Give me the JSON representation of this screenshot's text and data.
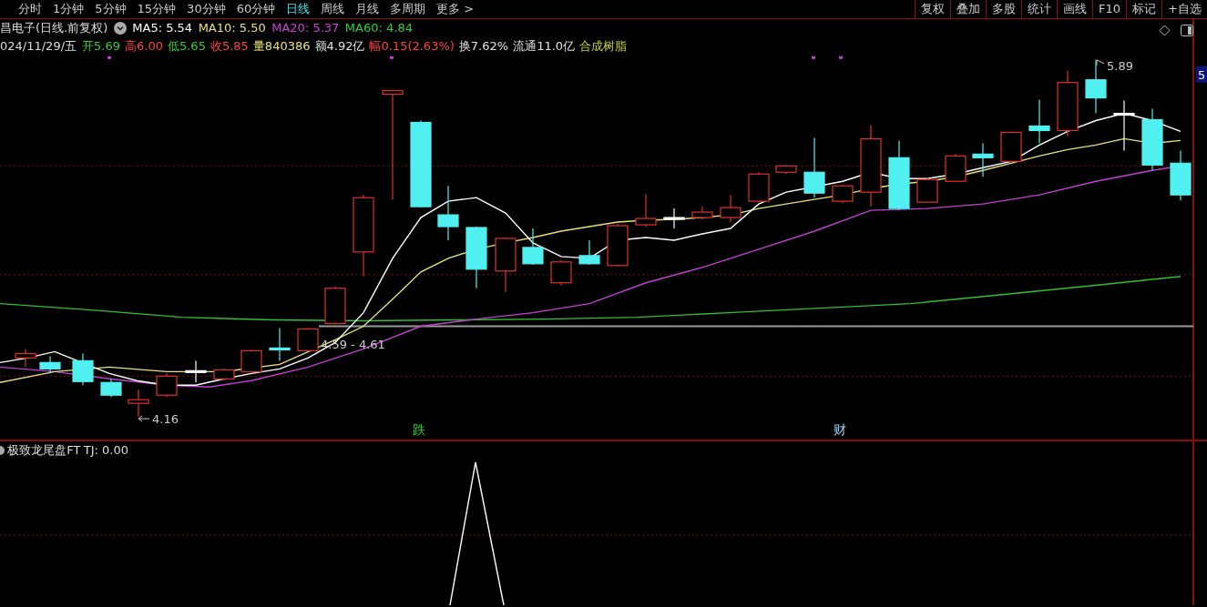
{
  "toolbar": {
    "period_tabs": [
      {
        "label": "分时",
        "selected": false
      },
      {
        "label": "1分钟",
        "selected": false
      },
      {
        "label": "5分钟",
        "selected": false
      },
      {
        "label": "15分钟",
        "selected": false
      },
      {
        "label": "30分钟",
        "selected": false
      },
      {
        "label": "60分钟",
        "selected": false
      },
      {
        "label": "日线",
        "selected": true
      },
      {
        "label": "周线",
        "selected": false
      },
      {
        "label": "月线",
        "selected": false
      },
      {
        "label": "多周期",
        "selected": false
      },
      {
        "label": "更多 >",
        "selected": false
      }
    ],
    "tools": [
      "复权",
      "叠加",
      "多股",
      "统计",
      "画线",
      "F10",
      "标记",
      "+自选"
    ]
  },
  "header": {
    "title": "昌电子(日线.前复权)",
    "ma": [
      {
        "label": "MA5: 5.54",
        "color": "#ffffff"
      },
      {
        "label": "MA10: 5.50",
        "color": "#e8e07a"
      },
      {
        "label": "MA20: 5.37",
        "color": "#d040d8"
      },
      {
        "label": "MA60: 4.84",
        "color": "#30d030"
      }
    ]
  },
  "quote": {
    "date": "024/11/29/五",
    "fields": [
      {
        "label": "开",
        "value": "5.69",
        "color": "#30d030"
      },
      {
        "label": "高",
        "value": "6.00",
        "color": "#ff4040"
      },
      {
        "label": "低",
        "value": "5.65",
        "color": "#30d030"
      },
      {
        "label": "收",
        "value": "5.85",
        "color": "#ff4040"
      },
      {
        "label": "量",
        "value": "840386",
        "color": "#e8e07a"
      },
      {
        "label": "额",
        "value": "4.92亿",
        "color": "#e0e0e0"
      },
      {
        "label": "幅",
        "value": "0.15(2.63%)",
        "color": "#ff4040"
      },
      {
        "label": "换",
        "value": "7.62%",
        "color": "#e0e0e0"
      },
      {
        "label": "流通",
        "value": "11.0亿",
        "color": "#e0e0e0"
      }
    ],
    "sector": "合成树脂"
  },
  "chart": {
    "annotations": [
      "5.89",
      "4.59 - 4.61",
      "4.16"
    ],
    "axis_label": "5",
    "markers": [
      {
        "text": "跌",
        "color": "#30d030"
      },
      {
        "text": "财",
        "color": "#a0d8ff"
      }
    ]
  },
  "indicator": {
    "title": "极致龙尾盘FT",
    "value": "TJ: 0.00"
  }
}
